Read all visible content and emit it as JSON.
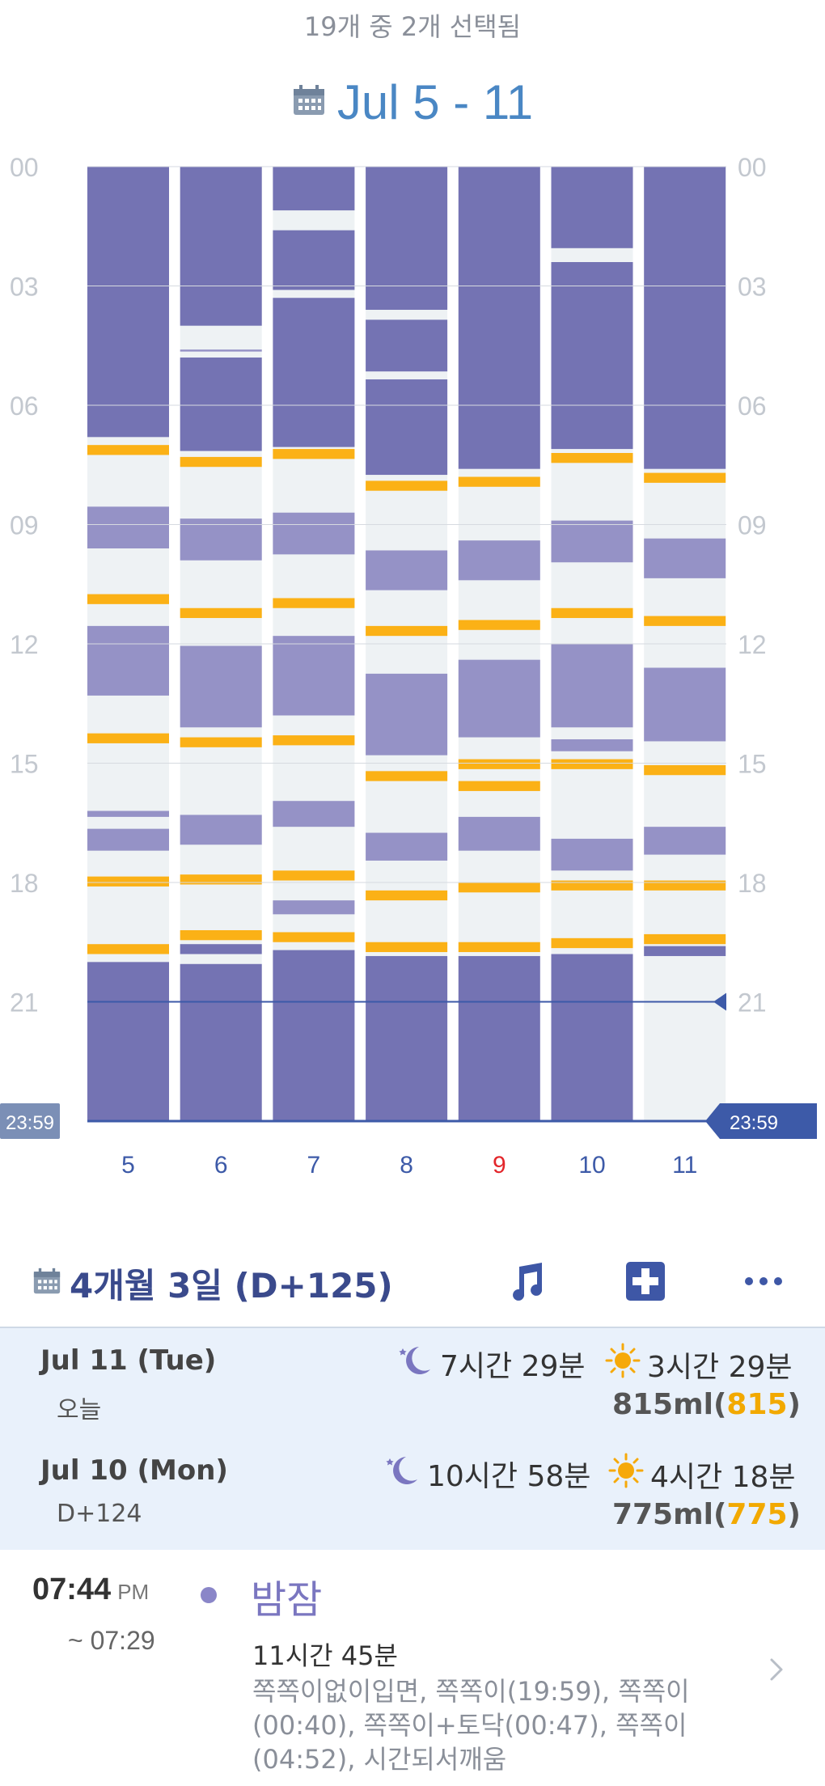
{
  "header": {
    "selection_text": "19개 중 2개 선택됨",
    "range_label": "Jul 5 - 11"
  },
  "chart_data": {
    "type": "bar",
    "title": "Jul 5 - 11",
    "categories": [
      "5",
      "6",
      "7",
      "8",
      "9",
      "10",
      "11"
    ],
    "y_tick_labels": [
      "00",
      "03",
      "06",
      "09",
      "12",
      "15",
      "18",
      "21"
    ],
    "y_range_hours": [
      0,
      24
    ],
    "end_label": "23:59",
    "current_time_marker_hour": 21,
    "highlight_category": "9",
    "colors": {
      "night_sleep": "#7473b3",
      "day_sleep": "#9592c6",
      "feeding": "#fbb116",
      "awake": "#eef2f4",
      "day_label": "#3d5aa8",
      "highlight_day": "#e3262b",
      "tick": "#c3c8cf"
    },
    "days": [
      {
        "day": "5",
        "segments": [
          {
            "type": "night",
            "start": 0,
            "end": 6.8
          },
          {
            "type": "feed",
            "start": 7.0,
            "end": 7.25
          },
          {
            "type": "nap",
            "start": 8.55,
            "end": 9.6
          },
          {
            "type": "feed",
            "start": 10.75,
            "end": 11.0
          },
          {
            "type": "nap",
            "start": 11.55,
            "end": 13.3
          },
          {
            "type": "feed",
            "start": 14.25,
            "end": 14.5
          },
          {
            "type": "nap",
            "start": 16.2,
            "end": 16.35
          },
          {
            "type": "nap",
            "start": 16.65,
            "end": 17.2
          },
          {
            "type": "feed",
            "start": 17.85,
            "end": 18.1
          },
          {
            "type": "feed",
            "start": 19.55,
            "end": 19.8
          },
          {
            "type": "night",
            "start": 20.0,
            "end": 24
          }
        ]
      },
      {
        "day": "6",
        "segments": [
          {
            "type": "night",
            "start": 0,
            "end": 4.0
          },
          {
            "type": "nap",
            "start": 4.6,
            "end": 4.65
          },
          {
            "type": "night",
            "start": 4.8,
            "end": 7.15
          },
          {
            "type": "feed",
            "start": 7.3,
            "end": 7.55
          },
          {
            "type": "nap",
            "start": 8.85,
            "end": 9.9
          },
          {
            "type": "feed",
            "start": 11.1,
            "end": 11.35
          },
          {
            "type": "nap",
            "start": 12.05,
            "end": 14.1
          },
          {
            "type": "feed",
            "start": 14.35,
            "end": 14.6
          },
          {
            "type": "nap",
            "start": 16.3,
            "end": 17.05
          },
          {
            "type": "feed",
            "start": 17.8,
            "end": 18.05
          },
          {
            "type": "feed",
            "start": 19.2,
            "end": 19.45
          },
          {
            "type": "night",
            "start": 19.55,
            "end": 19.8
          },
          {
            "type": "night",
            "start": 20.05,
            "end": 24
          }
        ]
      },
      {
        "day": "7",
        "segments": [
          {
            "type": "night",
            "start": 0,
            "end": 1.1
          },
          {
            "type": "night",
            "start": 1.6,
            "end": 3.1
          },
          {
            "type": "night",
            "start": 3.3,
            "end": 7.05
          },
          {
            "type": "feed",
            "start": 7.1,
            "end": 7.35
          },
          {
            "type": "nap",
            "start": 8.7,
            "end": 9.75
          },
          {
            "type": "feed",
            "start": 10.85,
            "end": 11.1
          },
          {
            "type": "nap",
            "start": 11.8,
            "end": 13.8
          },
          {
            "type": "feed",
            "start": 14.3,
            "end": 14.55
          },
          {
            "type": "nap",
            "start": 15.95,
            "end": 16.6
          },
          {
            "type": "feed",
            "start": 17.7,
            "end": 17.95
          },
          {
            "type": "nap",
            "start": 18.45,
            "end": 18.8
          },
          {
            "type": "feed",
            "start": 19.25,
            "end": 19.5
          },
          {
            "type": "night",
            "start": 19.7,
            "end": 24
          }
        ]
      },
      {
        "day": "8",
        "segments": [
          {
            "type": "night",
            "start": 0,
            "end": 3.6
          },
          {
            "type": "night",
            "start": 3.85,
            "end": 5.15
          },
          {
            "type": "night",
            "start": 5.35,
            "end": 7.75
          },
          {
            "type": "feed",
            "start": 7.9,
            "end": 8.15
          },
          {
            "type": "nap",
            "start": 9.65,
            "end": 10.65
          },
          {
            "type": "feed",
            "start": 11.55,
            "end": 11.8
          },
          {
            "type": "nap",
            "start": 12.75,
            "end": 14.8
          },
          {
            "type": "feed",
            "start": 15.2,
            "end": 15.45
          },
          {
            "type": "nap",
            "start": 16.75,
            "end": 17.45
          },
          {
            "type": "feed",
            "start": 18.2,
            "end": 18.45
          },
          {
            "type": "feed",
            "start": 19.5,
            "end": 19.75
          },
          {
            "type": "night",
            "start": 19.85,
            "end": 24
          }
        ]
      },
      {
        "day": "9",
        "segments": [
          {
            "type": "night",
            "start": 0,
            "end": 7.6
          },
          {
            "type": "feed",
            "start": 7.8,
            "end": 8.05
          },
          {
            "type": "nap",
            "start": 9.4,
            "end": 10.4
          },
          {
            "type": "feed",
            "start": 11.4,
            "end": 11.65
          },
          {
            "type": "nap",
            "start": 12.4,
            "end": 14.35
          },
          {
            "type": "feed",
            "start": 14.9,
            "end": 15.15
          },
          {
            "type": "feed",
            "start": 15.45,
            "end": 15.7
          },
          {
            "type": "nap",
            "start": 16.35,
            "end": 17.2
          },
          {
            "type": "feed",
            "start": 18.0,
            "end": 18.25
          },
          {
            "type": "feed",
            "start": 19.5,
            "end": 19.75
          },
          {
            "type": "night",
            "start": 19.85,
            "end": 24
          }
        ]
      },
      {
        "day": "10",
        "segments": [
          {
            "type": "night",
            "start": 0,
            "end": 2.05
          },
          {
            "type": "night",
            "start": 2.4,
            "end": 7.1
          },
          {
            "type": "feed",
            "start": 7.2,
            "end": 7.45
          },
          {
            "type": "nap",
            "start": 8.9,
            "end": 9.95
          },
          {
            "type": "feed",
            "start": 11.1,
            "end": 11.35
          },
          {
            "type": "nap",
            "start": 12.0,
            "end": 14.1
          },
          {
            "type": "nap",
            "start": 14.4,
            "end": 14.7
          },
          {
            "type": "feed",
            "start": 14.9,
            "end": 15.15
          },
          {
            "type": "nap",
            "start": 16.9,
            "end": 17.7
          },
          {
            "type": "feed",
            "start": 17.95,
            "end": 18.2
          },
          {
            "type": "feed",
            "start": 19.4,
            "end": 19.65
          },
          {
            "type": "night",
            "start": 19.8,
            "end": 24
          }
        ]
      },
      {
        "day": "11",
        "segments": [
          {
            "type": "night",
            "start": 0,
            "end": 7.6
          },
          {
            "type": "feed",
            "start": 7.7,
            "end": 7.95
          },
          {
            "type": "nap",
            "start": 9.35,
            "end": 10.35
          },
          {
            "type": "feed",
            "start": 11.3,
            "end": 11.55
          },
          {
            "type": "nap",
            "start": 12.6,
            "end": 14.45
          },
          {
            "type": "feed",
            "start": 15.05,
            "end": 15.3
          },
          {
            "type": "nap",
            "start": 16.6,
            "end": 17.3
          },
          {
            "type": "feed",
            "start": 17.95,
            "end": 18.2
          },
          {
            "type": "feed",
            "start": 19.3,
            "end": 19.55
          },
          {
            "type": "night",
            "start": 19.6,
            "end": 19.85
          }
        ]
      }
    ]
  },
  "age_bar": {
    "label": "4개월 3일 (D+125)",
    "icons": [
      "music-note-icon",
      "medical-cross-icon",
      "more-icon"
    ]
  },
  "summary": [
    {
      "date": "Jul 11 (Tue)",
      "sub": "오늘",
      "night": "7시간 29분",
      "day": "3시간 29분",
      "ml_main": "815ml",
      "ml_paren": "815"
    },
    {
      "date": "Jul 10 (Mon)",
      "sub": "D+124",
      "night": "10시간 58분",
      "day": "4시간 18분",
      "ml_main": "775ml",
      "ml_paren": "775"
    }
  ],
  "entry": {
    "time": "07:44",
    "ampm": "PM",
    "end_time": "~ 07:29",
    "title": "밤잠",
    "duration": "11시간 45분",
    "description": "쪽쪽이없이입면, 쪽쪽이(19:59), 쪽쪽이(00:40), 쪽쪽이+토닥(00:47), 쪽쪽이(04:52), 시간되서깨움"
  }
}
